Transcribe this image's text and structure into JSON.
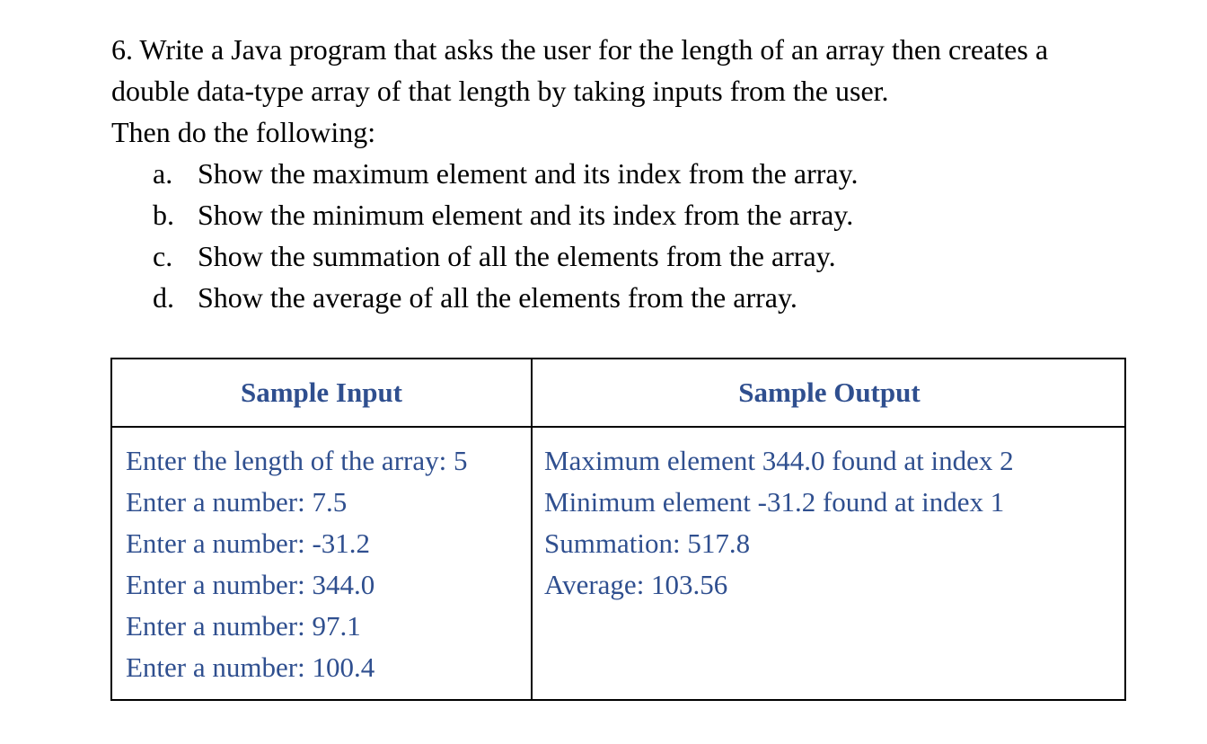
{
  "question": {
    "line1": "6. Write a Java program that asks the user for the length of an array then creates a",
    "line2": "double data-type array of that length by taking inputs from the user.",
    "line3": "Then do the following:",
    "items": [
      {
        "marker": "a.",
        "text": "Show the maximum element and its index from the array."
      },
      {
        "marker": "b.",
        "text": "Show the minimum element and its index from the array."
      },
      {
        "marker": "c.",
        "text": "Show the summation of all the elements from the array."
      },
      {
        "marker": "d.",
        "text": "Show the average of all the elements from the array."
      }
    ]
  },
  "table": {
    "header_input": "Sample Input",
    "header_output": "Sample Output",
    "input_lines": [
      "Enter the length of the array: 5",
      "Enter a number: 7.5",
      "Enter a number: -31.2",
      "Enter a number: 344.0",
      "Enter a number: 97.1",
      "Enter a number: 100.4"
    ],
    "output_lines": [
      "Maximum element 344.0 found at index 2",
      "Minimum element -31.2 found at index 1",
      "Summation: 517.8",
      "Average: 103.56"
    ],
    "text_color": "#2f4f8f"
  }
}
